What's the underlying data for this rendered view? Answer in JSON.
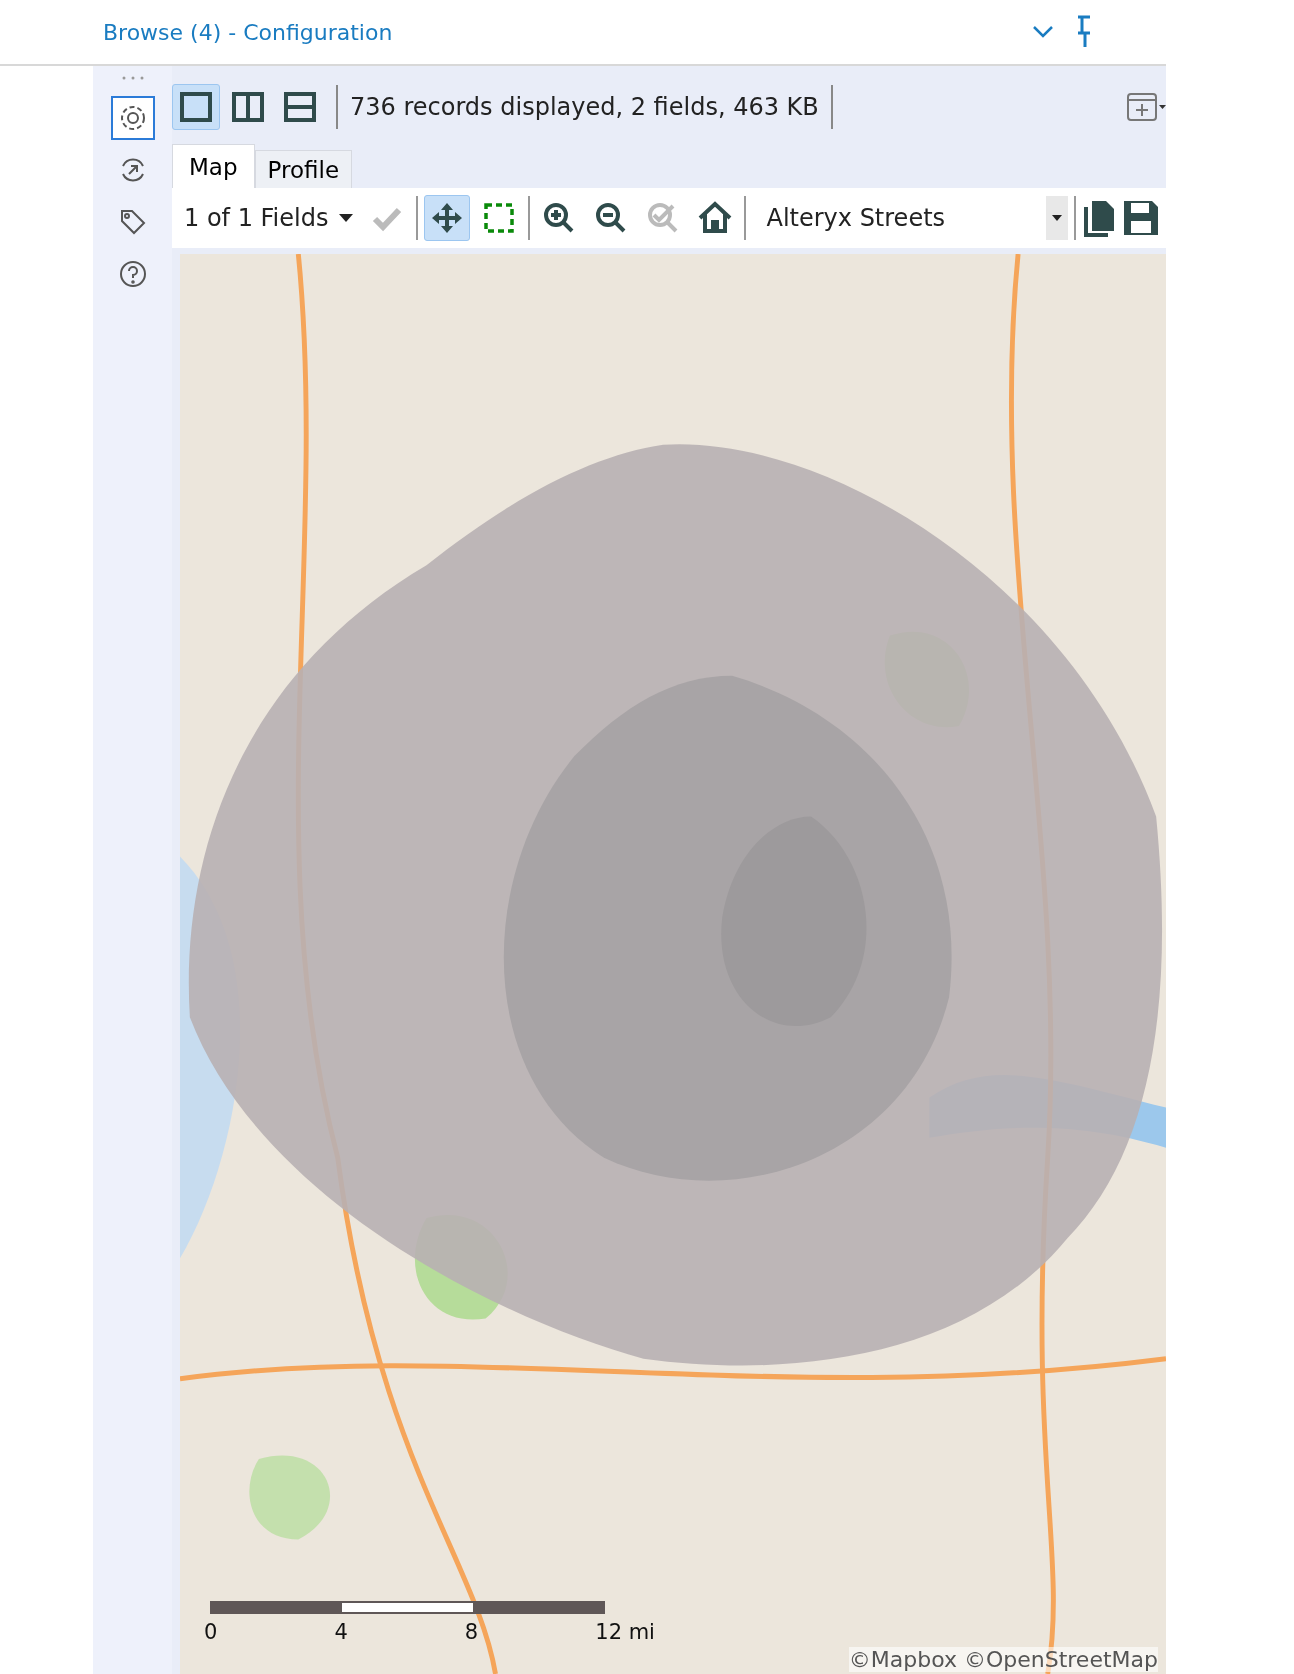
{
  "window": {
    "title": "Browse (4) - Configuration"
  },
  "sidebar": {
    "items": [
      {
        "kind": "gear",
        "selected": true
      },
      {
        "kind": "arrow-circle",
        "selected": false
      },
      {
        "kind": "tag",
        "selected": false
      },
      {
        "kind": "help",
        "selected": false
      }
    ]
  },
  "view_buttons": [
    {
      "kind": "single",
      "selected": true
    },
    {
      "kind": "columns",
      "selected": false
    },
    {
      "kind": "rows",
      "selected": false
    }
  ],
  "status": "736 records displayed, 2 fields, 463 KB",
  "tabs": [
    {
      "label": "Map",
      "selected": true
    },
    {
      "label": "Profile",
      "selected": false
    }
  ],
  "map_toolbar": {
    "fields": "1 of 1 Fields",
    "tools": [
      {
        "kind": "check",
        "selected": false,
        "disabled": true
      },
      {
        "kind": "pan",
        "selected": true,
        "disabled": false
      },
      {
        "kind": "select-rect",
        "selected": false,
        "disabled": false
      },
      {
        "kind": "zoom-in",
        "selected": false,
        "disabled": false
      },
      {
        "kind": "zoom-out",
        "selected": false,
        "disabled": false
      },
      {
        "kind": "check-select",
        "selected": false,
        "disabled": true
      },
      {
        "kind": "home",
        "selected": false,
        "disabled": false
      }
    ],
    "basemap": "Alteryx Streets"
  },
  "map": {
    "scale_labels": [
      "0",
      "4",
      "8",
      "12 mi"
    ],
    "attribution": "©Mapbox ©OpenStreetMap"
  }
}
